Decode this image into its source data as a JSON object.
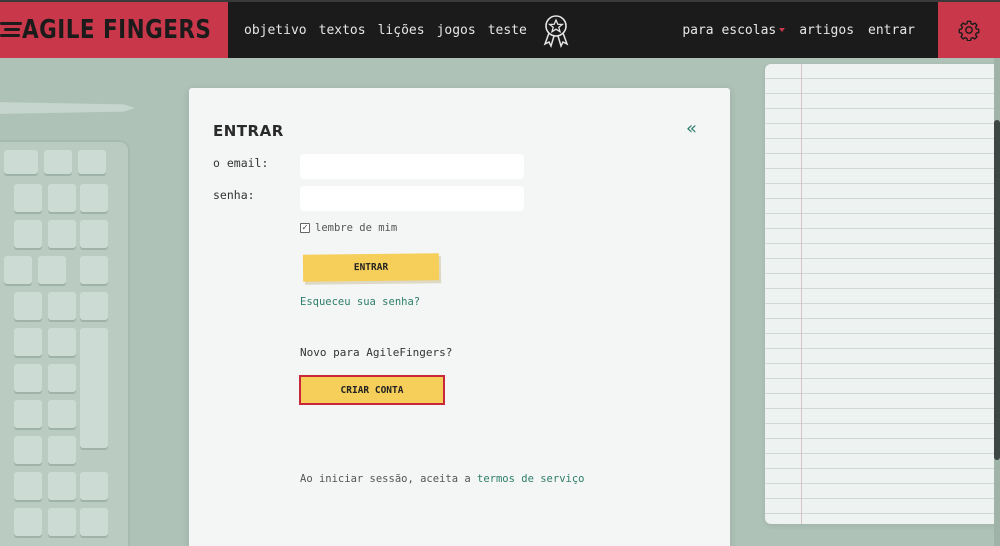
{
  "brand": {
    "logo_text": "AGILE FINGERS",
    "primary_color": "#c9384a",
    "accent_color": "#f5cf5a",
    "link_color": "#2e7d6a"
  },
  "nav": {
    "left_items": [
      "objetivo",
      "textos",
      "lições",
      "jogos",
      "teste"
    ],
    "award_icon": "award-ribbon-icon",
    "right_items": {
      "schools": "para escolas",
      "articles": "artigos",
      "login": "entrar"
    },
    "settings_icon": "gear-icon"
  },
  "login": {
    "title": "ENTRAR",
    "collapse_icon": "«",
    "email_label": "o email:",
    "email_value": "",
    "password_label": "senha:",
    "password_value": "",
    "remember_label": "lembre de mim",
    "remember_checked": true,
    "checkmark": "✓",
    "submit_label": "ENTRAR",
    "forgot_label": "Esqueceu sua senha?",
    "new_user_text": "Novo para AgileFingers?",
    "create_label": "CRIAR CONTA",
    "terms_prefix": "Ao iniciar sessão, aceita a ",
    "terms_link": "termos de serviço"
  }
}
